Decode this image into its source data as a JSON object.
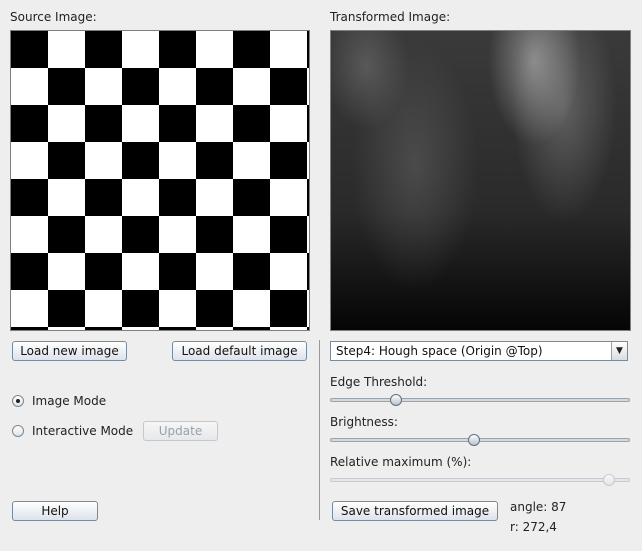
{
  "source": {
    "title": "Source Image:",
    "load_new_label": "Load new image",
    "load_default_label": "Load default image"
  },
  "transformed": {
    "title": "Transformed Image:",
    "step_select_value": "Step4: Hough space (Origin @Top)",
    "save_label": "Save transformed image"
  },
  "modes": {
    "image_mode_label": "Image Mode",
    "interactive_mode_label": "Interactive Mode",
    "update_label": "Update",
    "selected": "Image Mode"
  },
  "sliders": {
    "edge_threshold_label": "Edge Threshold:",
    "edge_threshold_value": 0.22,
    "brightness_label": "Brightness:",
    "brightness_value": 0.48,
    "relative_max_label": "Relative maximum (%):",
    "relative_max_value": 0.93
  },
  "help_label": "Help",
  "readout": {
    "angle": "angle: 87",
    "r": "r: 272,4"
  },
  "icons": {
    "dropdown": "chevron-down-icon"
  }
}
